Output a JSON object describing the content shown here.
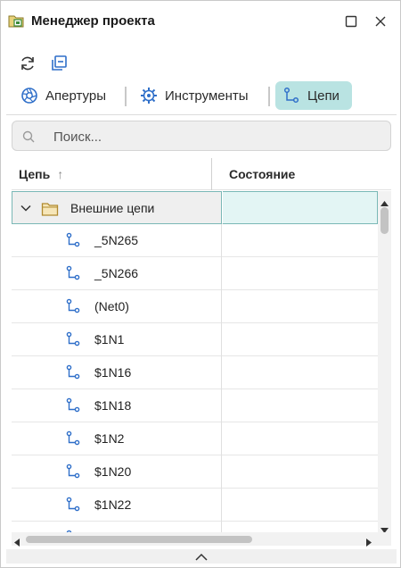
{
  "window": {
    "title": "Менеджер проекта"
  },
  "toolbar": {
    "refresh_icon": "refresh-icon",
    "collapse_icon": "collapse-all-icon"
  },
  "tabs": [
    {
      "label": "Апертуры",
      "icon": "aperture-icon",
      "active": false
    },
    {
      "label": "Инструменты",
      "icon": "tool-icon",
      "active": false
    },
    {
      "label": "Цепи",
      "icon": "net-icon",
      "active": true
    }
  ],
  "search": {
    "placeholder": "Поиск..."
  },
  "table": {
    "columns": [
      {
        "label": "Цепь",
        "sort": "↑"
      },
      {
        "label": "Состояние"
      }
    ],
    "group": {
      "label": "Внешние цепи",
      "expanded": true
    },
    "rows": [
      {
        "label": "_5N265"
      },
      {
        "label": "_5N266"
      },
      {
        "label": "(Net0)"
      },
      {
        "label": "$1N1"
      },
      {
        "label": "$1N16"
      },
      {
        "label": "$1N18"
      },
      {
        "label": "$1N2"
      },
      {
        "label": "$1N20"
      },
      {
        "label": "$1N22"
      }
    ]
  },
  "colors": {
    "accent": "#b9e3e2",
    "icon_blue": "#2f6fc9",
    "folder": "#c9a14a"
  }
}
